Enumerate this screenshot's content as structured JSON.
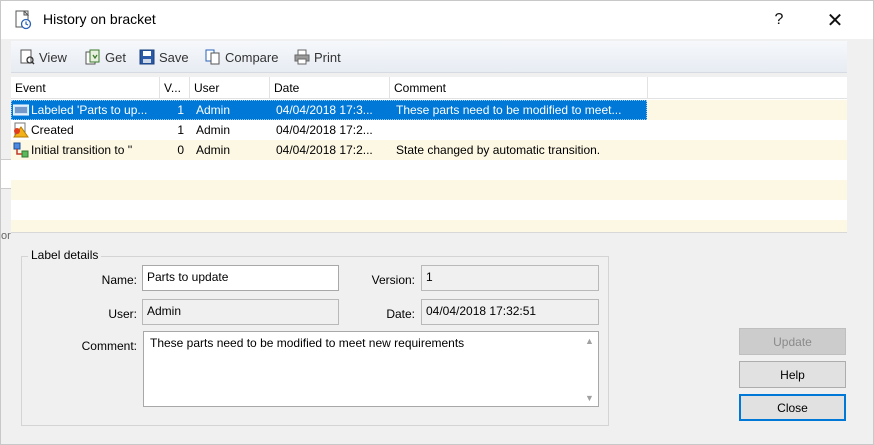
{
  "window": {
    "title": "History on bracket",
    "help_glyph": "?",
    "close_glyph": "✕"
  },
  "toolbar": {
    "view": "View",
    "get": "Get",
    "save": "Save",
    "compare": "Compare",
    "print": "Print"
  },
  "grid": {
    "columns": [
      "Event",
      "V...",
      "User",
      "Date",
      "Comment"
    ],
    "rows": [
      {
        "event": "Labeled 'Parts to up...",
        "version": "1",
        "user": "Admin",
        "date": "04/04/2018 17:3...",
        "comment": "These parts need to be modified to meet...",
        "icon": "label-icon",
        "selected": true
      },
      {
        "event": "Created",
        "version": "1",
        "user": "Admin",
        "date": "04/04/2018 17:2...",
        "comment": "",
        "icon": "created-icon",
        "selected": false
      },
      {
        "event": "Initial transition to ''",
        "version": "0",
        "user": "Admin",
        "date": "04/04/2018 17:2...",
        "comment": "State changed by automatic transition.",
        "icon": "transition-icon",
        "selected": false
      }
    ]
  },
  "left_edge_text": "or",
  "details": {
    "group_title": "Label details",
    "name_label": "Name:",
    "name_value": "Parts to update",
    "version_label": "Version:",
    "version_value": "1",
    "user_label": "User:",
    "user_value": "Admin",
    "date_label": "Date:",
    "date_value": "04/04/2018 17:32:51",
    "comment_label": "Comment:",
    "comment_value": "These parts need to be modified to meet new requirements"
  },
  "buttons": {
    "update": "Update",
    "help": "Help",
    "close": "Close"
  }
}
